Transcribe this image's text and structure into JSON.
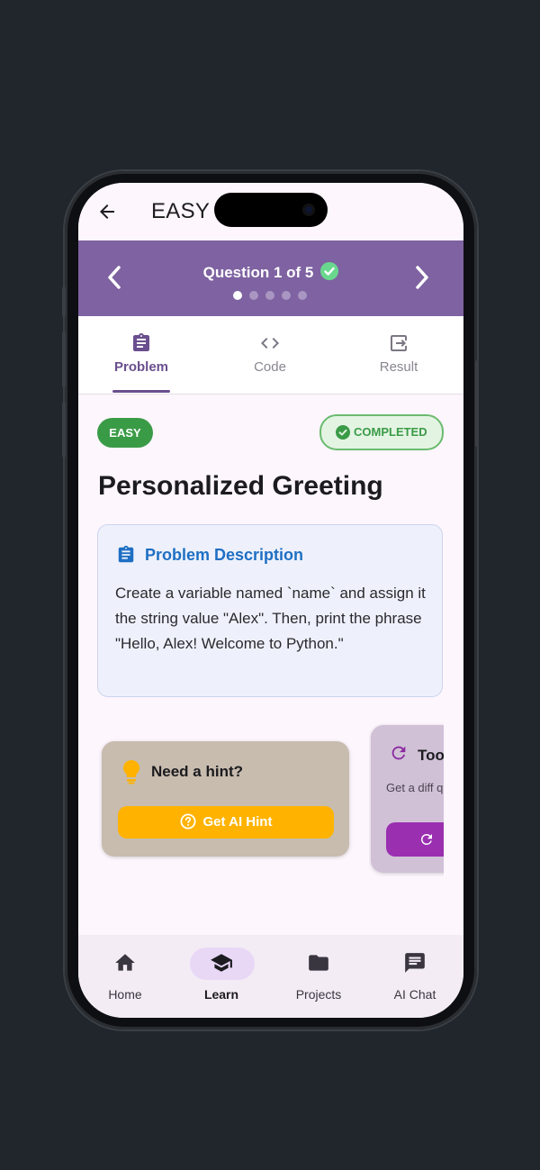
{
  "appbar": {
    "title": "EASY C"
  },
  "question_nav": {
    "title": "Question 1 of 5",
    "dots": 5,
    "active_dot": 1
  },
  "tabs": [
    {
      "label": "Problem",
      "icon": "clipboard-icon",
      "active": true
    },
    {
      "label": "Code",
      "icon": "code-icon",
      "active": false
    },
    {
      "label": "Result",
      "icon": "output-icon",
      "active": false
    }
  ],
  "problem": {
    "difficulty": "EASY",
    "status": "COMPLETED",
    "title": "Personalized Greeting",
    "description_heading": "Problem Description",
    "description": "Create a variable named `name` and assign it the string value \"Alex\". Then, print the phrase \"Hello, Alex! Welcome to Python.\""
  },
  "hint_card": {
    "title": "Need a hint?",
    "button_label": "Get AI Hint"
  },
  "tough_card": {
    "title": "Too",
    "subtitle": "Get a diff questi"
  },
  "bottom_nav": [
    {
      "label": "Home",
      "icon": "home-icon",
      "active": false
    },
    {
      "label": "Learn",
      "icon": "graduation-cap-icon",
      "active": true
    },
    {
      "label": "Projects",
      "icon": "folder-icon",
      "active": false
    },
    {
      "label": "AI Chat",
      "icon": "chat-icon",
      "active": false
    }
  ],
  "colors": {
    "primary": "#7e62a1",
    "easy_badge": "#3a9b47",
    "hint_button": "#ffb300",
    "description_accent": "#1e6fc4",
    "tough_button": "#9a2fb0"
  }
}
